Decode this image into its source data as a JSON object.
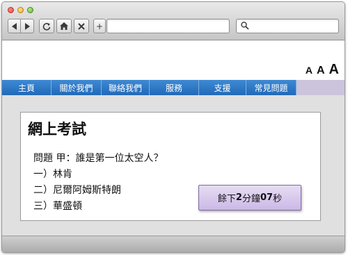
{
  "toolbar": {
    "back_icon": "triangle-left",
    "forward_icon": "triangle-right",
    "reload_icon": "reload",
    "home_icon": "house",
    "stop_icon": "x",
    "new_tab_label": "+",
    "address_value": "",
    "search_value": "",
    "search_icon": "magnifier"
  },
  "font_size": {
    "small": "A",
    "medium": "A",
    "large": "A"
  },
  "nav": {
    "items": [
      {
        "label": "主頁"
      },
      {
        "label": "關於我們"
      },
      {
        "label": "聯絡我們"
      },
      {
        "label": "服務"
      },
      {
        "label": "支援"
      },
      {
        "label": "常見問題"
      }
    ],
    "accent": "#2b77c6"
  },
  "exam": {
    "title": "網上考試",
    "question": "問題 甲：誰是第一位太空人？",
    "options": [
      {
        "label": "一）林肯"
      },
      {
        "label": "二）尼爾阿姆斯特朗"
      },
      {
        "label": "三）華盛頓"
      }
    ]
  },
  "timer": {
    "prefix": "餘下 ",
    "minutes": "2",
    "minutes_unit": "分鐘",
    "seconds": "07",
    "seconds_unit": " 秒",
    "color": "#d8c9ee"
  }
}
